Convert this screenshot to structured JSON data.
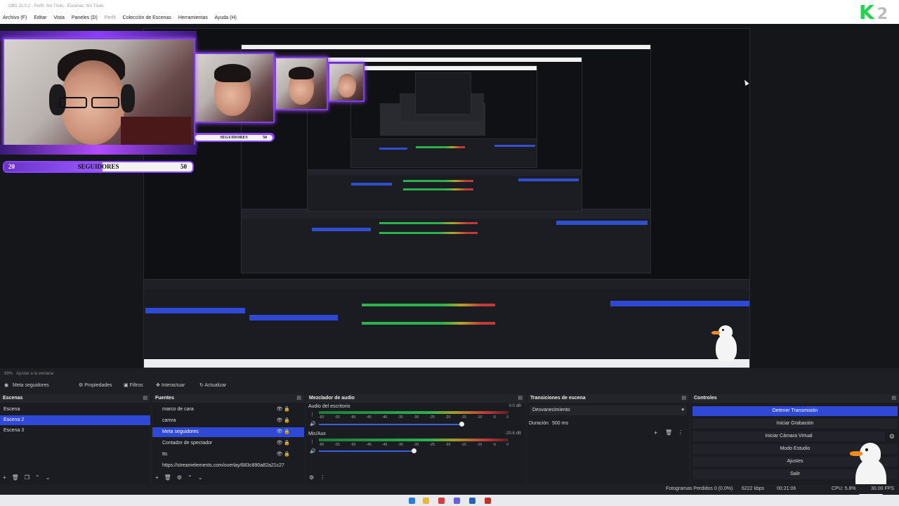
{
  "window": {
    "title": "OBS 31.0.2 - Perfil: Sin Título - Escenas: Sin Título",
    "logo_letter": "K",
    "logo_number": "2"
  },
  "menu": [
    "Archivo (F)",
    "Editar",
    "Vista",
    "Paneles (D)",
    "Perfil",
    "Colección de Escenas",
    "Herramientas",
    "Ayuda (H)"
  ],
  "overlay": {
    "followers_left": "20",
    "followers_label": "SEGUIDORES",
    "followers_right": "50"
  },
  "preview": {
    "scale_label": "89%",
    "fit_label": "Ajustar a la ventana"
  },
  "scene_toolbar": {
    "current_source": "Meta seguidores",
    "properties": "Propiedades",
    "filters": "Filtros",
    "interact": "Interactuar",
    "refresh": "Actualizar"
  },
  "scenes": {
    "title": "Escenas",
    "items": [
      "Escena",
      "Escena 2",
      "Escena 3"
    ],
    "selected_index": 1
  },
  "sources": {
    "title": "Fuentes",
    "items": [
      "marco de cara",
      "camra",
      "Meta seguidores",
      "Contador de spectador",
      "tts",
      "https://streamelements.com/overlay/683c890a82a21c27"
    ],
    "selected_index": 2
  },
  "mixer": {
    "title": "Mezclador de audio",
    "ticks": [
      "-60",
      "-55",
      "-50",
      "-45",
      "-40",
      "-35",
      "-30",
      "-25",
      "-20",
      "-15",
      "-10",
      "-5",
      "0"
    ],
    "channels": [
      {
        "name": "Audio del escritorio",
        "db": "0.0 dB",
        "level": 0.75
      },
      {
        "name": "Mic/Aux",
        "db": "-20.6 dB",
        "level": 0.5
      }
    ]
  },
  "transitions": {
    "title": "Transiciones de escena",
    "selected": "Desvanecimiento",
    "duration_label": "Duración",
    "duration_value": "500 ms"
  },
  "controls": {
    "title": "Controles",
    "buttons": [
      "Detener Transmisión",
      "Iniciar Grabación",
      "Iniciar Cámara Virtual",
      "Modo Estudio",
      "Ajustes",
      "Salir"
    ]
  },
  "status": {
    "dropped": "Fotogramas Perdidos 0 (0.0%)",
    "bitrate": "6222 kbps",
    "time": "00:21:06",
    "cpu": "CPU: 5.8%",
    "fps": "30.00 FPS"
  },
  "colors": {
    "accent": "#2f49d6",
    "panel": "#1b1c21",
    "overlay_purple": "#8b44ff",
    "logo_green": "#21d44f"
  }
}
